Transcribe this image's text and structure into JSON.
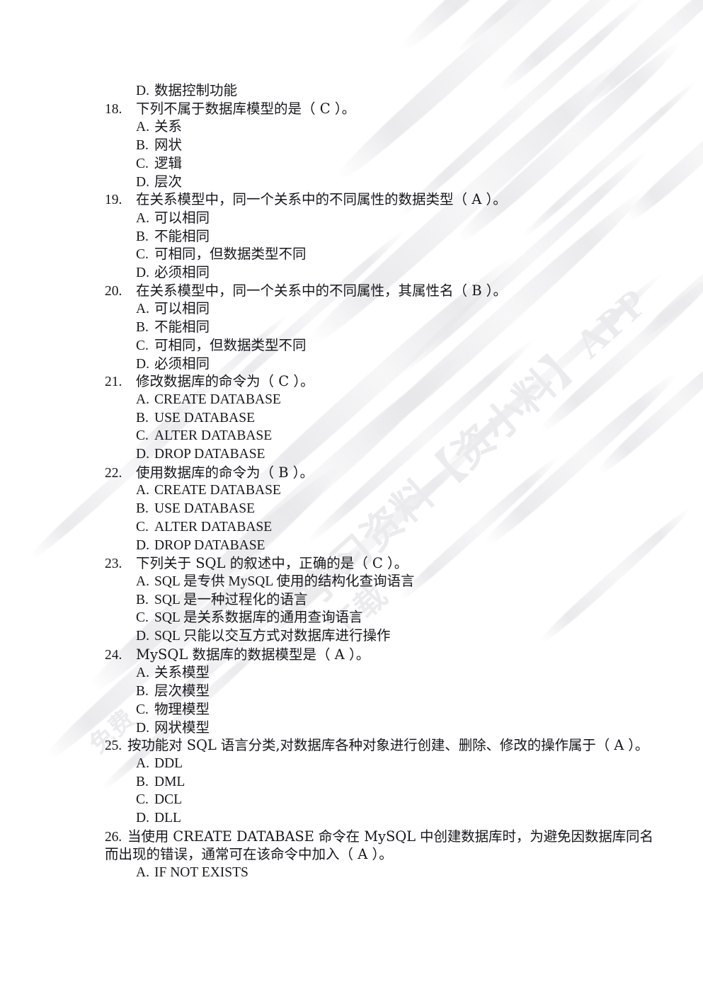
{
  "document": {
    "page_background": "#ffffff",
    "text_color": "#17171d",
    "watermark_color": "#ebebee",
    "watermark_texts": [
      "学习资料【资小料】APP",
      "下载",
      "免费"
    ]
  },
  "orphan_option": {
    "letter": "D.",
    "text": "数据控制功能"
  },
  "questions": [
    {
      "number": "18.",
      "stem": "下列不属于数据库模型的是（  C ）。",
      "answer": "C",
      "options": [
        {
          "letter": "A.",
          "text": "关系"
        },
        {
          "letter": "B.",
          "text": "网状"
        },
        {
          "letter": "C.",
          "text": "逻辑"
        },
        {
          "letter": "D.",
          "text": "层次"
        }
      ]
    },
    {
      "number": "19.",
      "stem": "在关系模型中，同一个关系中的不同属性的数据类型（  A ）。",
      "answer": "A",
      "options": [
        {
          "letter": "A.",
          "text": "可以相同"
        },
        {
          "letter": "B.",
          "text": "不能相同"
        },
        {
          "letter": "C.",
          "text": "可相同，但数据类型不同"
        },
        {
          "letter": "D.",
          "text": "必须相同"
        }
      ]
    },
    {
      "number": "20.",
      "stem": "在关系模型中，同一个关系中的不同属性，其属性名（   B ）。",
      "answer": "B",
      "options": [
        {
          "letter": "A.",
          "text": "可以相同"
        },
        {
          "letter": "B.",
          "text": "不能相同"
        },
        {
          "letter": "C.",
          "text": "可相同，但数据类型不同"
        },
        {
          "letter": "D.",
          "text": "必须相同"
        }
      ]
    },
    {
      "number": "21.",
      "stem": "修改数据库的命令为（  C  ）。",
      "answer": "C",
      "options": [
        {
          "letter": "A.",
          "text": "CREATE DATABASE"
        },
        {
          "letter": "B.",
          "text": "USE DATABASE"
        },
        {
          "letter": "C.",
          "text": "ALTER DATABASE"
        },
        {
          "letter": "D.",
          "text": "DROP DATABASE"
        }
      ]
    },
    {
      "number": "22.",
      "stem": "使用数据库的命令为（ B  ）。",
      "answer": "B",
      "options": [
        {
          "letter": "A.",
          "text": "CREATE DATABASE"
        },
        {
          "letter": "B.",
          "text": "USE DATABASE"
        },
        {
          "letter": "C.",
          "text": "ALTER DATABASE"
        },
        {
          "letter": "D.",
          "text": "DROP DATABASE"
        }
      ]
    },
    {
      "number": "23.",
      "stem": "下列关于 SQL 的叙述中，正确的是（ C ）。",
      "answer": "C",
      "options": [
        {
          "letter": "A.",
          "text": "SQL 是专供 MySQL 使用的结构化查询语言"
        },
        {
          "letter": "B.",
          "text": "SQL 是一种过程化的语言"
        },
        {
          "letter": "C.",
          "text": "SQL 是关系数据库的通用查询语言"
        },
        {
          "letter": "D.",
          "text": "SQL 只能以交互方式对数据库进行操作"
        }
      ]
    },
    {
      "number": "24.",
      "stem": "MySQL 数据库的数据模型是（   A  ）。",
      "answer": "A",
      "options": [
        {
          "letter": "A.",
          "text": "关系模型"
        },
        {
          "letter": "B.",
          "text": "层次模型"
        },
        {
          "letter": "C.",
          "text": "物理模型"
        },
        {
          "letter": "D.",
          "text": "网状模型"
        }
      ]
    },
    {
      "number": "25.",
      "stem": "按功能对 SQL 语言分类,对数据库各种对象进行创建、删除、修改的操作属于（  A  ）。",
      "answer": "A",
      "options": [
        {
          "letter": "A.",
          "text": "DDL"
        },
        {
          "letter": "B.",
          "text": "DML"
        },
        {
          "letter": "C.",
          "text": "DCL"
        },
        {
          "letter": "D.",
          "text": "DLL"
        }
      ]
    },
    {
      "number": "26.",
      "stem": "当使用 CREATE DATABASE 命令在 MySQL 中创建数据库时，为避免因数据库同名",
      "stem_cont": "而出现的错误，通常可在该命令中加入（  A  ）。",
      "answer": "A",
      "options": [
        {
          "letter": "A.",
          "text": "IF NOT EXISTS"
        }
      ]
    }
  ]
}
